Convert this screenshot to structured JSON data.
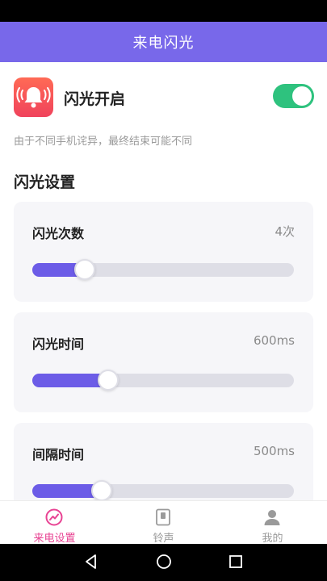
{
  "header": {
    "title": "来电闪光"
  },
  "flash": {
    "label": "闪光开启",
    "enabled": true
  },
  "hint": "由于不同手机诧异，最终结束可能不同",
  "section_title": "闪光设置",
  "settings": [
    {
      "label": "闪光次数",
      "value": "4次",
      "fraction": 0.2
    },
    {
      "label": "闪光时间",
      "value": "600ms",
      "fraction": 0.29
    },
    {
      "label": "间隔时间",
      "value": "500ms",
      "fraction": 0.265
    }
  ],
  "nav": [
    {
      "label": "来电设置",
      "icon": "activity-icon",
      "active": true
    },
    {
      "label": "铃声",
      "icon": "ringtone-icon",
      "active": false
    },
    {
      "label": "我的",
      "icon": "user-icon",
      "active": false
    }
  ],
  "colors": {
    "header": "#7868ea",
    "accent": "#6c5ce7",
    "toggle_on": "#2ec27e",
    "nav_active": "#e84393",
    "nav_inactive": "#9a9a9a"
  }
}
